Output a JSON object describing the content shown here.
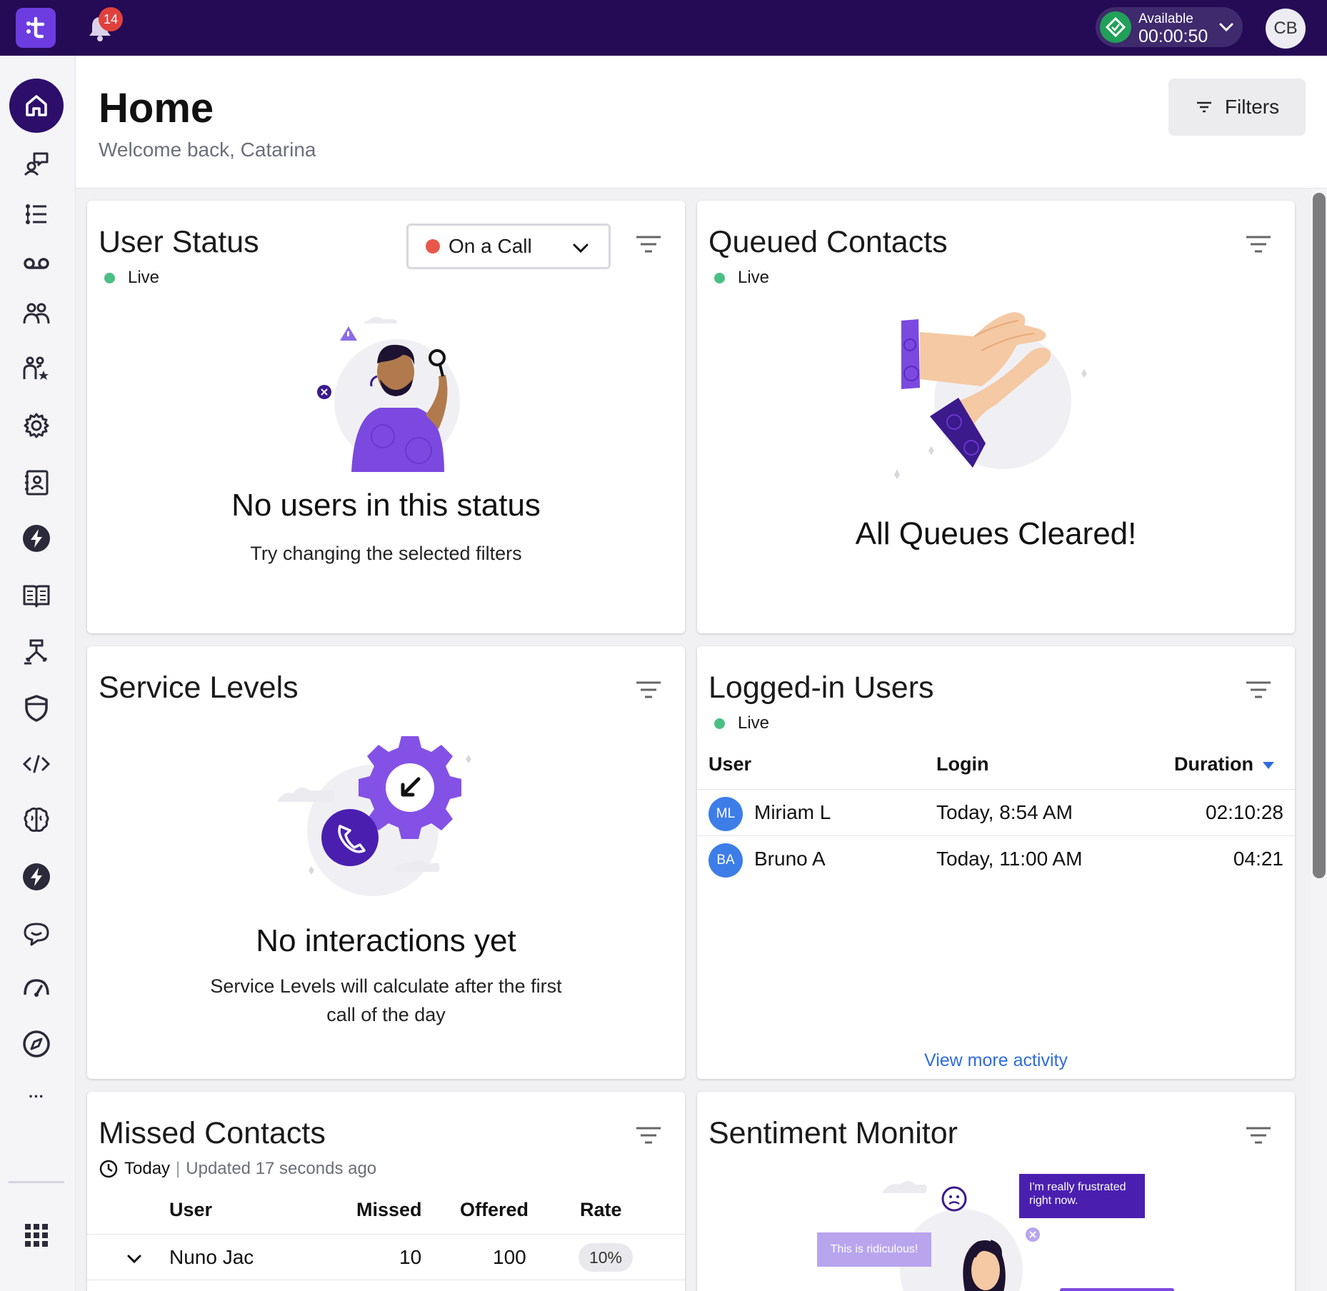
{
  "topbar": {
    "notifications_count": "14",
    "availability": {
      "label": "Available",
      "timer": "00:00:50"
    },
    "avatar_initials": "CB"
  },
  "sidebar": {
    "items": [
      {
        "icon": "home-icon",
        "active": true
      },
      {
        "icon": "conversation-icon"
      },
      {
        "icon": "list-icon"
      },
      {
        "icon": "voicemail-icon"
      },
      {
        "icon": "users-icon"
      },
      {
        "icon": "user-rating-icon"
      },
      {
        "icon": "gear-icon"
      },
      {
        "icon": "contact-book-icon"
      },
      {
        "icon": "bolt-icon"
      },
      {
        "icon": "book-icon"
      },
      {
        "icon": "flow-icon"
      },
      {
        "icon": "shield-icon"
      },
      {
        "icon": "code-icon"
      },
      {
        "icon": "brain-icon"
      },
      {
        "icon": "bolt-icon"
      },
      {
        "icon": "chat-bubble-icon"
      },
      {
        "icon": "speedometer-icon"
      },
      {
        "icon": "compass-icon"
      },
      {
        "icon": "more-icon"
      }
    ],
    "more_label": "···",
    "apps_icon": "grid-icon"
  },
  "header": {
    "title": "Home",
    "subtitle": "Welcome back, Catarina",
    "filters_label": "Filters"
  },
  "user_status": {
    "title": "User Status",
    "live_label": "Live",
    "selected_status": "On a Call",
    "empty_title": "No users in this status",
    "empty_sub": "Try changing the selected filters"
  },
  "queued_contacts": {
    "title": "Queued Contacts",
    "live_label": "Live",
    "empty_title": "All Queues Cleared!"
  },
  "service_levels": {
    "title": "Service Levels",
    "empty_title": "No interactions yet",
    "empty_sub_line1": "Service Levels will calculate after the first",
    "empty_sub_line2": "call of the day"
  },
  "logged_in_users": {
    "title": "Logged-in Users",
    "live_label": "Live",
    "columns": {
      "user": "User",
      "login": "Login",
      "duration": "Duration"
    },
    "rows": [
      {
        "initials": "ML",
        "name": "Miriam L",
        "login": "Today, 8:54 AM",
        "duration": "02:10:28"
      },
      {
        "initials": "BA",
        "name": "Bruno A",
        "login": "Today, 11:00 AM",
        "duration": "04:21"
      }
    ],
    "view_more": "View more activity"
  },
  "missed_contacts": {
    "title": "Missed Contacts",
    "period": "Today",
    "separator": "|",
    "updated": "Updated 17 seconds ago",
    "columns": {
      "user": "User",
      "missed": "Missed",
      "offered": "Offered",
      "rate": "Rate"
    },
    "rows": [
      {
        "user": "Nuno Jac",
        "missed": "10",
        "offered": "100",
        "rate": "10%"
      }
    ]
  },
  "sentiment_monitor": {
    "title": "Sentiment Monitor",
    "bubble_frustrated_line1": "I'm really frustrated",
    "bubble_frustrated_line2": "right now.",
    "bubble_ridiculous": "This is ridiculous!"
  },
  "colors": {
    "topbar": "#250a55",
    "accent_purple": "#6c3ce0",
    "live_green": "#4bbf86",
    "status_red": "#e9574a",
    "link_blue": "#2d6cdf"
  }
}
